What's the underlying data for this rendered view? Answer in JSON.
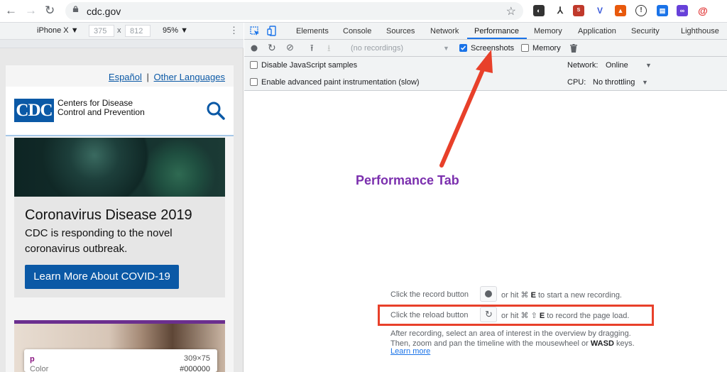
{
  "browser": {
    "url": "cdc.gov",
    "icons": [
      "back-arrow-icon",
      "forward-arrow-icon",
      "reload-icon",
      "lock-icon",
      "star-icon"
    ],
    "extension_icons": [
      "incognito-icon",
      "tools-icon",
      "seo-icon",
      "v-icon",
      "lighthouse-icon",
      "info-icon",
      "wallet-icon",
      "link-icon",
      "spiral-icon"
    ]
  },
  "device_toolbar": {
    "device": "iPhone X ▼",
    "width": "375",
    "times": "x",
    "height": "812",
    "zoom": "95% ▼",
    "more": "⋮"
  },
  "site": {
    "lang_spanish": "Español",
    "lang_separator": "|",
    "lang_other": "Other Languages",
    "logo": "CDC",
    "org_line1": "Centers for Disease",
    "org_line2": "Control and Prevention",
    "card_title": "Coronavirus Disease 2019",
    "card_text": "CDC is responding to the novel coronavirus outbreak.",
    "card_button": "Learn More About COVID-19",
    "inspect_tag": "p",
    "inspect_dims": "309×75",
    "inspect_color_label": "Color",
    "inspect_color_value": "#000000"
  },
  "devtools": {
    "tabs": [
      "Elements",
      "Console",
      "Sources",
      "Network",
      "Performance",
      "Memory",
      "Application",
      "Security",
      "Lighthouse"
    ],
    "active_tab": "Performance",
    "recordings_placeholder": "(no recordings)",
    "screenshots_label": "Screenshots",
    "screenshots_checked": true,
    "memory_label": "Memory",
    "memory_checked": false,
    "disable_js_label": "Disable JavaScript samples",
    "paint_label": "Enable advanced paint instrumentation (slow)",
    "network_label": "Network:",
    "network_value": "Online",
    "cpu_label": "CPU:",
    "cpu_value": "No throttling",
    "instr_record_pre": "Click the record button",
    "instr_record_post_a": "or hit ⌘",
    "instr_record_key": "E",
    "instr_record_post_b": "to start a new recording.",
    "instr_reload_pre": "Click the reload button",
    "instr_reload_post_a": "or hit ⌘ ⇧",
    "instr_reload_key": "E",
    "instr_reload_post_b": "to record the page load.",
    "instr_after_1": "After recording, select an area of interest in the overview by dragging.",
    "instr_after_2a": "Then, zoom and pan the timeline with the mousewheel or",
    "instr_after_2_key": "WASD",
    "instr_after_2b": "keys.",
    "learn_more": "Learn more"
  },
  "annotation": {
    "label": "Performance Tab",
    "label_color": "#7b2fae",
    "arrow_color": "#e8402a",
    "highlight_color": "#e8402a"
  }
}
